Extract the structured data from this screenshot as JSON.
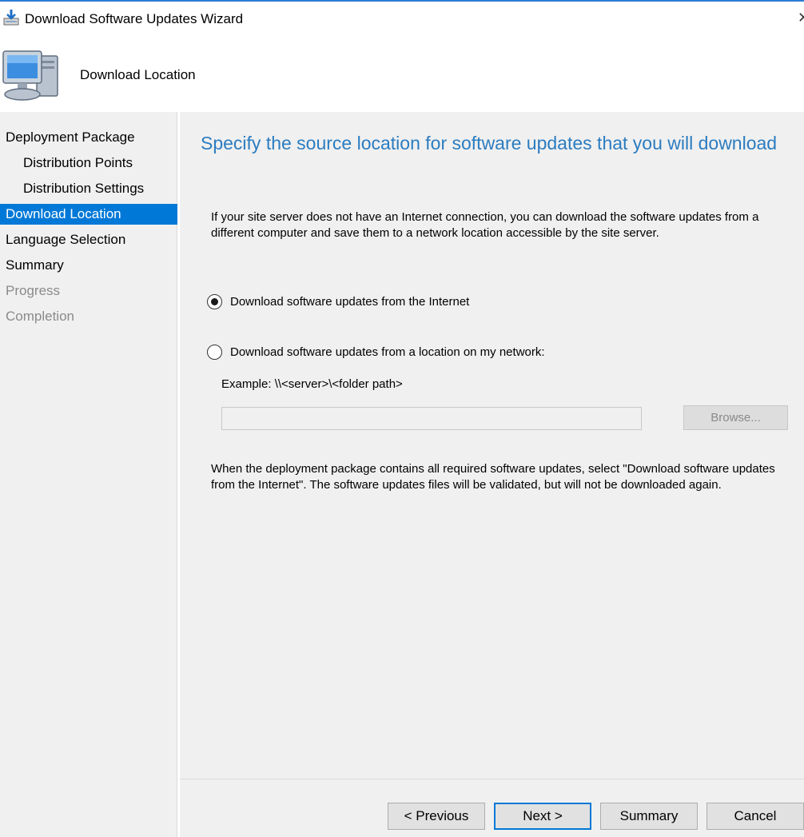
{
  "window": {
    "title": "Download Software Updates Wizard",
    "accent_color": "#0078d7",
    "title_icon": "download-icon"
  },
  "header": {
    "title": "Download Location",
    "icon": "computer-icon"
  },
  "sidebar": {
    "items": [
      {
        "label": "Deployment Package",
        "state": "normal",
        "level": 0
      },
      {
        "label": "Distribution Points",
        "state": "normal",
        "level": 1
      },
      {
        "label": "Distribution Settings",
        "state": "normal",
        "level": 1
      },
      {
        "label": "Download Location",
        "state": "active",
        "level": 0
      },
      {
        "label": "Language Selection",
        "state": "normal",
        "level": 0
      },
      {
        "label": "Summary",
        "state": "normal",
        "level": 0
      },
      {
        "label": "Progress",
        "state": "disabled",
        "level": 0
      },
      {
        "label": "Completion",
        "state": "disabled",
        "level": 0
      }
    ]
  },
  "main": {
    "heading": "Specify the source location for software updates that you will download",
    "heading_color": "#2b7cc0",
    "intro": "If your site server does not have an Internet connection, you can download the software updates from a different computer and save them to a network location accessible by the site server.",
    "options": [
      {
        "label": "Download software updates from the Internet",
        "selected": true
      },
      {
        "label": "Download software updates from a location on my network:",
        "selected": false
      }
    ],
    "example": "Example: \\\\<server>\\<folder path>",
    "path_value": "",
    "browse_label": "Browse...",
    "note": "When the deployment package contains all required software updates, select \"Download  software updates from the Internet\". The software updates files will be validated, but will not be downloaded again."
  },
  "footer": {
    "previous_label": "< Previous",
    "next_label": "Next >",
    "summary_label": "Summary",
    "cancel_label": "Cancel"
  }
}
